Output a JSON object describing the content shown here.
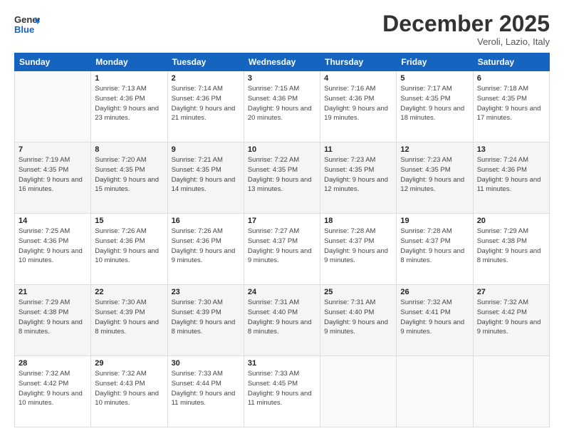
{
  "logo": {
    "line1": "General",
    "line2": "Blue"
  },
  "title": "December 2025",
  "location": "Veroli, Lazio, Italy",
  "weekdays": [
    "Sunday",
    "Monday",
    "Tuesday",
    "Wednesday",
    "Thursday",
    "Friday",
    "Saturday"
  ],
  "weeks": [
    [
      {
        "day": "",
        "sunrise": "",
        "sunset": "",
        "daylight": ""
      },
      {
        "day": "1",
        "sunrise": "Sunrise: 7:13 AM",
        "sunset": "Sunset: 4:36 PM",
        "daylight": "Daylight: 9 hours and 23 minutes."
      },
      {
        "day": "2",
        "sunrise": "Sunrise: 7:14 AM",
        "sunset": "Sunset: 4:36 PM",
        "daylight": "Daylight: 9 hours and 21 minutes."
      },
      {
        "day": "3",
        "sunrise": "Sunrise: 7:15 AM",
        "sunset": "Sunset: 4:36 PM",
        "daylight": "Daylight: 9 hours and 20 minutes."
      },
      {
        "day": "4",
        "sunrise": "Sunrise: 7:16 AM",
        "sunset": "Sunset: 4:36 PM",
        "daylight": "Daylight: 9 hours and 19 minutes."
      },
      {
        "day": "5",
        "sunrise": "Sunrise: 7:17 AM",
        "sunset": "Sunset: 4:35 PM",
        "daylight": "Daylight: 9 hours and 18 minutes."
      },
      {
        "day": "6",
        "sunrise": "Sunrise: 7:18 AM",
        "sunset": "Sunset: 4:35 PM",
        "daylight": "Daylight: 9 hours and 17 minutes."
      }
    ],
    [
      {
        "day": "7",
        "sunrise": "Sunrise: 7:19 AM",
        "sunset": "Sunset: 4:35 PM",
        "daylight": "Daylight: 9 hours and 16 minutes."
      },
      {
        "day": "8",
        "sunrise": "Sunrise: 7:20 AM",
        "sunset": "Sunset: 4:35 PM",
        "daylight": "Daylight: 9 hours and 15 minutes."
      },
      {
        "day": "9",
        "sunrise": "Sunrise: 7:21 AM",
        "sunset": "Sunset: 4:35 PM",
        "daylight": "Daylight: 9 hours and 14 minutes."
      },
      {
        "day": "10",
        "sunrise": "Sunrise: 7:22 AM",
        "sunset": "Sunset: 4:35 PM",
        "daylight": "Daylight: 9 hours and 13 minutes."
      },
      {
        "day": "11",
        "sunrise": "Sunrise: 7:23 AM",
        "sunset": "Sunset: 4:35 PM",
        "daylight": "Daylight: 9 hours and 12 minutes."
      },
      {
        "day": "12",
        "sunrise": "Sunrise: 7:23 AM",
        "sunset": "Sunset: 4:35 PM",
        "daylight": "Daylight: 9 hours and 12 minutes."
      },
      {
        "day": "13",
        "sunrise": "Sunrise: 7:24 AM",
        "sunset": "Sunset: 4:36 PM",
        "daylight": "Daylight: 9 hours and 11 minutes."
      }
    ],
    [
      {
        "day": "14",
        "sunrise": "Sunrise: 7:25 AM",
        "sunset": "Sunset: 4:36 PM",
        "daylight": "Daylight: 9 hours and 10 minutes."
      },
      {
        "day": "15",
        "sunrise": "Sunrise: 7:26 AM",
        "sunset": "Sunset: 4:36 PM",
        "daylight": "Daylight: 9 hours and 10 minutes."
      },
      {
        "day": "16",
        "sunrise": "Sunrise: 7:26 AM",
        "sunset": "Sunset: 4:36 PM",
        "daylight": "Daylight: 9 hours and 9 minutes."
      },
      {
        "day": "17",
        "sunrise": "Sunrise: 7:27 AM",
        "sunset": "Sunset: 4:37 PM",
        "daylight": "Daylight: 9 hours and 9 minutes."
      },
      {
        "day": "18",
        "sunrise": "Sunrise: 7:28 AM",
        "sunset": "Sunset: 4:37 PM",
        "daylight": "Daylight: 9 hours and 9 minutes."
      },
      {
        "day": "19",
        "sunrise": "Sunrise: 7:28 AM",
        "sunset": "Sunset: 4:37 PM",
        "daylight": "Daylight: 9 hours and 8 minutes."
      },
      {
        "day": "20",
        "sunrise": "Sunrise: 7:29 AM",
        "sunset": "Sunset: 4:38 PM",
        "daylight": "Daylight: 9 hours and 8 minutes."
      }
    ],
    [
      {
        "day": "21",
        "sunrise": "Sunrise: 7:29 AM",
        "sunset": "Sunset: 4:38 PM",
        "daylight": "Daylight: 9 hours and 8 minutes."
      },
      {
        "day": "22",
        "sunrise": "Sunrise: 7:30 AM",
        "sunset": "Sunset: 4:39 PM",
        "daylight": "Daylight: 9 hours and 8 minutes."
      },
      {
        "day": "23",
        "sunrise": "Sunrise: 7:30 AM",
        "sunset": "Sunset: 4:39 PM",
        "daylight": "Daylight: 9 hours and 8 minutes."
      },
      {
        "day": "24",
        "sunrise": "Sunrise: 7:31 AM",
        "sunset": "Sunset: 4:40 PM",
        "daylight": "Daylight: 9 hours and 8 minutes."
      },
      {
        "day": "25",
        "sunrise": "Sunrise: 7:31 AM",
        "sunset": "Sunset: 4:40 PM",
        "daylight": "Daylight: 9 hours and 9 minutes."
      },
      {
        "day": "26",
        "sunrise": "Sunrise: 7:32 AM",
        "sunset": "Sunset: 4:41 PM",
        "daylight": "Daylight: 9 hours and 9 minutes."
      },
      {
        "day": "27",
        "sunrise": "Sunrise: 7:32 AM",
        "sunset": "Sunset: 4:42 PM",
        "daylight": "Daylight: 9 hours and 9 minutes."
      }
    ],
    [
      {
        "day": "28",
        "sunrise": "Sunrise: 7:32 AM",
        "sunset": "Sunset: 4:42 PM",
        "daylight": "Daylight: 9 hours and 10 minutes."
      },
      {
        "day": "29",
        "sunrise": "Sunrise: 7:32 AM",
        "sunset": "Sunset: 4:43 PM",
        "daylight": "Daylight: 9 hours and 10 minutes."
      },
      {
        "day": "30",
        "sunrise": "Sunrise: 7:33 AM",
        "sunset": "Sunset: 4:44 PM",
        "daylight": "Daylight: 9 hours and 11 minutes."
      },
      {
        "day": "31",
        "sunrise": "Sunrise: 7:33 AM",
        "sunset": "Sunset: 4:45 PM",
        "daylight": "Daylight: 9 hours and 11 minutes."
      },
      {
        "day": "",
        "sunrise": "",
        "sunset": "",
        "daylight": ""
      },
      {
        "day": "",
        "sunrise": "",
        "sunset": "",
        "daylight": ""
      },
      {
        "day": "",
        "sunrise": "",
        "sunset": "",
        "daylight": ""
      }
    ]
  ]
}
